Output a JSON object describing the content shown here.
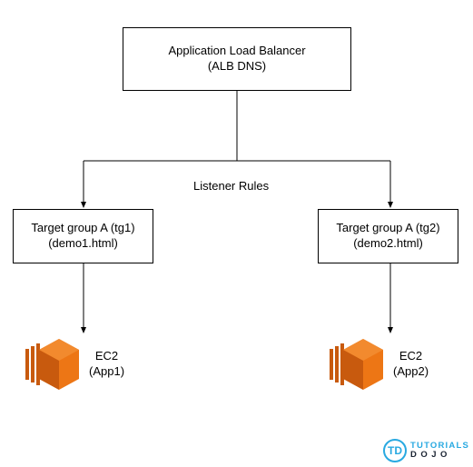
{
  "alb": {
    "title": "Application Load Balancer",
    "subtitle": "(ALB DNS)"
  },
  "listener_label": "Listener Rules",
  "target_groups": [
    {
      "name": "Target group A (tg1)",
      "resource": "(demo1.html)"
    },
    {
      "name": "Target group A (tg2)",
      "resource": "(demo2.html)"
    }
  ],
  "instances": [
    {
      "name": "EC2",
      "app": "(App1)"
    },
    {
      "name": "EC2",
      "app": "(App2)"
    }
  ],
  "watermark": {
    "initials": "TD",
    "line1": "TUTORIALS",
    "line2": "DOJO"
  },
  "colors": {
    "ec2_orange": "#ED7615",
    "ec2_dark": "#C85A0E",
    "brand_blue": "#28a9e1",
    "brand_dark": "#1a2332"
  }
}
